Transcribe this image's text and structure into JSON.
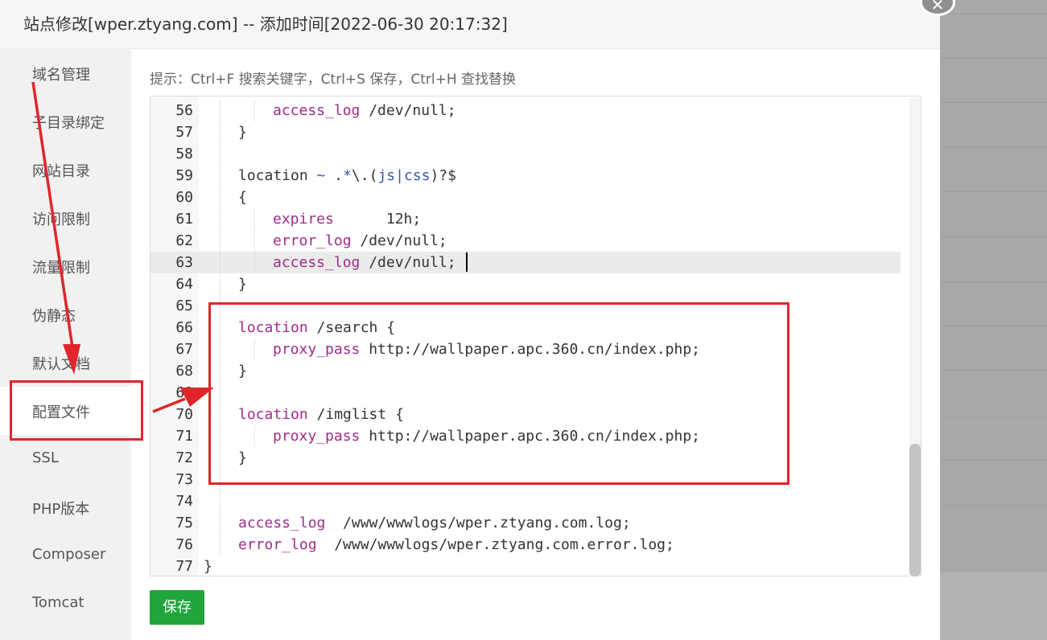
{
  "window": {
    "title": "站点修改[wper.ztyang.com] -- 添加时间[2022-06-30 20:17:32]",
    "close_glyph": "✕"
  },
  "sidebar": {
    "items": [
      {
        "label": "域名管理"
      },
      {
        "label": "子目录绑定"
      },
      {
        "label": "网站目录"
      },
      {
        "label": "访问限制"
      },
      {
        "label": "流量限制"
      },
      {
        "label": "伪静态"
      },
      {
        "label": "默认文档"
      },
      {
        "label": "配置文件",
        "active": true
      },
      {
        "label": "SSL"
      },
      {
        "label": "PHP版本"
      },
      {
        "label": "Composer"
      },
      {
        "label": "Tomcat"
      }
    ]
  },
  "editor": {
    "hint": "提示：Ctrl+F 搜索关键字，Ctrl+S 保存，Ctrl+H 查找替换",
    "current_line": "63",
    "lines": [
      {
        "n": "56",
        "indent": 2,
        "parts": [
          [
            "kw",
            "access_log"
          ],
          [
            "t",
            " /dev/null;"
          ]
        ]
      },
      {
        "n": "57",
        "indent": 1,
        "parts": [
          [
            "t",
            "}"
          ]
        ]
      },
      {
        "n": "58",
        "indent": 1,
        "parts": []
      },
      {
        "n": "59",
        "indent": 1,
        "parts": [
          [
            "t",
            "location "
          ],
          [
            "op",
            "~"
          ],
          [
            "t",
            " ."
          ],
          [
            "op",
            "*"
          ],
          [
            "t",
            "\\.("
          ],
          [
            "op",
            "js|css"
          ],
          [
            "t",
            ")?$"
          ]
        ]
      },
      {
        "n": "60",
        "indent": 1,
        "parts": [
          [
            "t",
            "{"
          ]
        ]
      },
      {
        "n": "61",
        "indent": 2,
        "parts": [
          [
            "kw",
            "expires"
          ],
          [
            "t",
            "      12h;"
          ]
        ]
      },
      {
        "n": "62",
        "indent": 2,
        "parts": [
          [
            "kw",
            "error_log"
          ],
          [
            "t",
            " /dev/null;"
          ]
        ]
      },
      {
        "n": "63",
        "indent": 2,
        "parts": [
          [
            "kw",
            "access_log"
          ],
          [
            "t",
            " /dev/null;"
          ]
        ]
      },
      {
        "n": "64",
        "indent": 1,
        "parts": [
          [
            "t",
            "}"
          ]
        ]
      },
      {
        "n": "65",
        "indent": 1,
        "parts": []
      },
      {
        "n": "66",
        "indent": 1,
        "parts": [
          [
            "kw",
            "location"
          ],
          [
            "t",
            " /search {"
          ]
        ]
      },
      {
        "n": "67",
        "indent": 2,
        "parts": [
          [
            "kw",
            "proxy_pass"
          ],
          [
            "t",
            " http://wallpaper.apc.360.cn/index.php;"
          ]
        ]
      },
      {
        "n": "68",
        "indent": 1,
        "parts": [
          [
            "t",
            "}"
          ]
        ]
      },
      {
        "n": "69",
        "indent": 1,
        "parts": []
      },
      {
        "n": "70",
        "indent": 1,
        "parts": [
          [
            "kw",
            "location"
          ],
          [
            "t",
            " /imglist {"
          ]
        ]
      },
      {
        "n": "71",
        "indent": 2,
        "parts": [
          [
            "kw",
            "proxy_pass"
          ],
          [
            "t",
            " http://wallpaper.apc.360.cn/index.php;"
          ]
        ]
      },
      {
        "n": "72",
        "indent": 1,
        "parts": [
          [
            "t",
            "}"
          ]
        ]
      },
      {
        "n": "73",
        "indent": 1,
        "parts": []
      },
      {
        "n": "74",
        "indent": 1,
        "parts": []
      },
      {
        "n": "75",
        "indent": 1,
        "parts": [
          [
            "kw",
            "access_log"
          ],
          [
            "t",
            "  /www/wwwlogs/wper.ztyang.com.log;"
          ]
        ]
      },
      {
        "n": "76",
        "indent": 1,
        "parts": [
          [
            "kw",
            "error_log"
          ],
          [
            "t",
            "  /www/wwwlogs/wper.ztyang.com.error.log;"
          ]
        ]
      },
      {
        "n": "77",
        "indent": 0,
        "parts": [
          [
            "t",
            "}"
          ]
        ]
      }
    ]
  },
  "actions": {
    "save_label": "保存"
  },
  "colors": {
    "annotation_red": "#e0262c",
    "save_green": "#20a53a",
    "keyword": "#a02b8a",
    "operator": "#3c55b0"
  }
}
